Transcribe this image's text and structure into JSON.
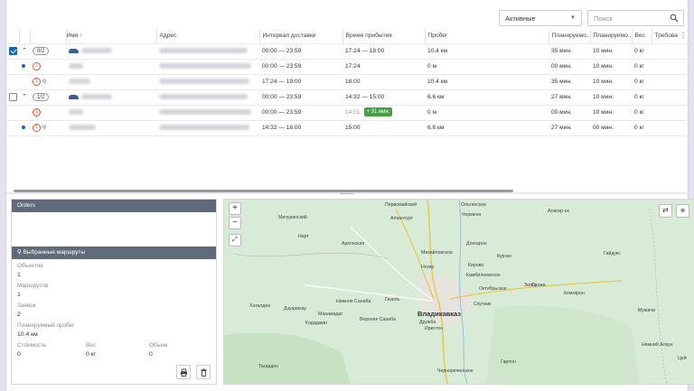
{
  "toolbar": {
    "filter_value": "Активные",
    "search_placeholder": "Поиск"
  },
  "columns": [
    "Имя ↑",
    "Адрес",
    "Интервал доставки",
    "Время прибытия",
    "Пробег",
    "Планируемо...",
    "Планируемо...",
    "Вес",
    "Требова"
  ],
  "rows": [
    {
      "type": "route",
      "counter": "0/2",
      "interval": "00:00 — 23:59",
      "arrival": "17:24 — 18:00",
      "mileage": "10.4 км",
      "plan1": "35 мин.",
      "plan2": "10 мин.",
      "weight": "0 кг"
    },
    {
      "type": "stop",
      "interval": "00:00 — 23:59",
      "arrival": "17:24",
      "mileage": "0 м",
      "plan1": "00 мин.",
      "plan2": "10 мин.",
      "weight": "0 кг"
    },
    {
      "type": "stop",
      "num": "1",
      "interval": "17:24 — 19:00",
      "arrival": "18:00",
      "mileage": "10.4 км",
      "plan1": "35 мин.",
      "plan2": "10 мин.",
      "weight": "0 кг"
    },
    {
      "type": "route",
      "counter": "1/2",
      "interval": "00:00 — 23:59",
      "arrival": "14:32 — 15:00",
      "mileage": "6.6 км",
      "plan1": "27 мин.",
      "plan2": "10 мин.",
      "weight": "0 кг"
    },
    {
      "type": "stop",
      "interval": "00:00 — 23:59",
      "arrival": "14:01",
      "badge": "+ 31 мин.",
      "mileage": "0 м",
      "plan1": "00 мин.",
      "plan2": "10 мин.",
      "weight": "0 кг"
    },
    {
      "type": "stop",
      "num": "1",
      "interval": "14:32 — 18:00",
      "arrival": "15:00",
      "mileage": "6.6 км",
      "plan1": "27 мин.",
      "plan2": "00 мин.",
      "weight": "0 кг"
    }
  ],
  "orders_panel": {
    "title": "Orders"
  },
  "routes_panel": {
    "title": "Выбранные маршруты",
    "objects_label": "Объектов",
    "objects": "1",
    "routes_label": "Маршрутов",
    "routes": "1",
    "requests_label": "Заявок",
    "requests": "2",
    "mileage_label": "Планируемый пробег",
    "mileage": "10.4 км",
    "cost_label": "Стоимость",
    "cost": "0",
    "weight_label": "Вес",
    "weight": "0 кг",
    "volume_label": "Объем",
    "volume": "0"
  },
  "map": {
    "labels": [
      "Первомайский",
      "Ольгинское",
      "Мичуринский",
      "Алханчурт",
      "Черменн",
      "Алагир-ос",
      "Нарт",
      "Михайловское",
      "Архонская",
      "Донгарон",
      "Ногир",
      "Кирово",
      "Камбилеевское",
      "Курган",
      "Зилга",
      "Октябрьское",
      "Сунжа",
      "Комгарон",
      "Гайдукс",
      "Гизель",
      "Нижняя Саниба",
      "Дзуарикау",
      "Мааамадаг",
      "Кодаджин",
      "Хаталдон",
      "Верхняя Саниба",
      "Владикавказ",
      "Спутник",
      "Иристон",
      "Дружба",
      "Мужичи",
      "Нижний Алкун",
      "Тагардон",
      "Чернореченское",
      "Гарпон",
      "Цей"
    ],
    "big_label": "Владикавказ"
  }
}
